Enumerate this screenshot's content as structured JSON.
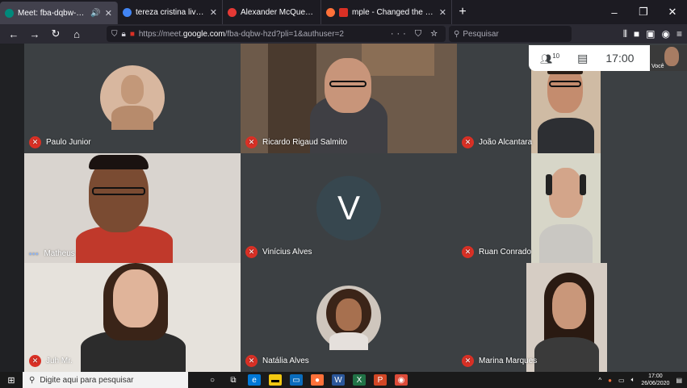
{
  "browser": {
    "tabs": [
      {
        "title": "Meet: fba-dqbw-hzd",
        "active": true,
        "fav_color": "#00897b"
      },
      {
        "title": "tereza cristina live - Pesquisa G...",
        "active": false,
        "fav_color": "#4285f4"
      },
      {
        "title": "Alexander McQueen explicou...",
        "active": false,
        "fav_color": "#e53935"
      },
      {
        "title": "mple - Changed the way yo...",
        "active": false,
        "fav_color": "#ff7139"
      }
    ],
    "url_prefix": "https://meet.",
    "url_host": "google.com",
    "url_path": "/fba-dqbw-hzd?pli=1&authuser=2",
    "search_placeholder": "Pesquisar"
  },
  "meet": {
    "participant_count": "10",
    "clock": "17:00",
    "self_label": "Você",
    "participants": [
      {
        "name": "Paulo Junior",
        "muted": true
      },
      {
        "name": "Ricardo Rigaud Salmito",
        "muted": true
      },
      {
        "name": "João Alcantara",
        "muted": true
      },
      {
        "name": "Matheus",
        "muted": false
      },
      {
        "name": "Vinícius Alves",
        "muted": true,
        "initial": "V"
      },
      {
        "name": "Ruan Conrado",
        "muted": true
      },
      {
        "name": "Juh Mr.",
        "muted": true
      },
      {
        "name": "Natália Alves",
        "muted": true
      },
      {
        "name": "Marina Marques",
        "muted": true
      }
    ]
  },
  "taskbar": {
    "search_placeholder": "Digite aqui para pesquisar",
    "time": "17:00",
    "date": "26/06/2020"
  }
}
